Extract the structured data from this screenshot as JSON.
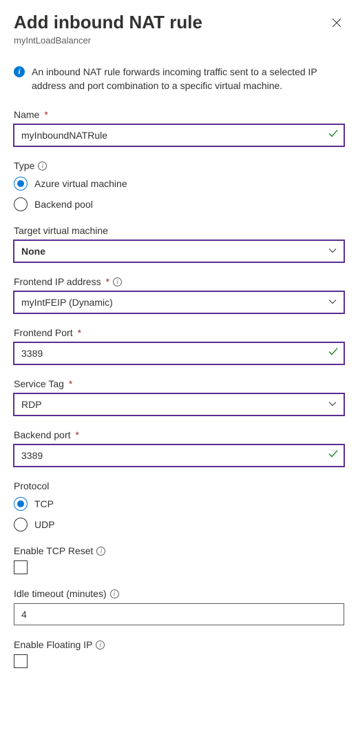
{
  "header": {
    "title": "Add inbound NAT rule",
    "subtitle": "myIntLoadBalancer"
  },
  "info": {
    "text": "An inbound NAT rule forwards incoming traffic sent to a selected IP address and port combination to a specific virtual machine."
  },
  "fields": {
    "name": {
      "label": "Name",
      "value": "myInboundNATRule"
    },
    "type": {
      "label": "Type",
      "options": {
        "avm": "Azure virtual machine",
        "bpool": "Backend pool"
      },
      "selected": "avm"
    },
    "targetVm": {
      "label": "Target virtual machine",
      "value": "None"
    },
    "frontendIp": {
      "label": "Frontend IP address",
      "value": "myIntFEIP (Dynamic)"
    },
    "frontendPort": {
      "label": "Frontend Port",
      "value": "3389"
    },
    "serviceTag": {
      "label": "Service Tag",
      "value": "RDP"
    },
    "backendPort": {
      "label": "Backend port",
      "value": "3389"
    },
    "protocol": {
      "label": "Protocol",
      "options": {
        "tcp": "TCP",
        "udp": "UDP"
      },
      "selected": "tcp"
    },
    "tcpReset": {
      "label": "Enable TCP Reset",
      "checked": false
    },
    "idleTimeout": {
      "label": "Idle timeout (minutes)",
      "value": "4"
    },
    "floatingIp": {
      "label": "Enable Floating IP",
      "checked": false
    }
  }
}
